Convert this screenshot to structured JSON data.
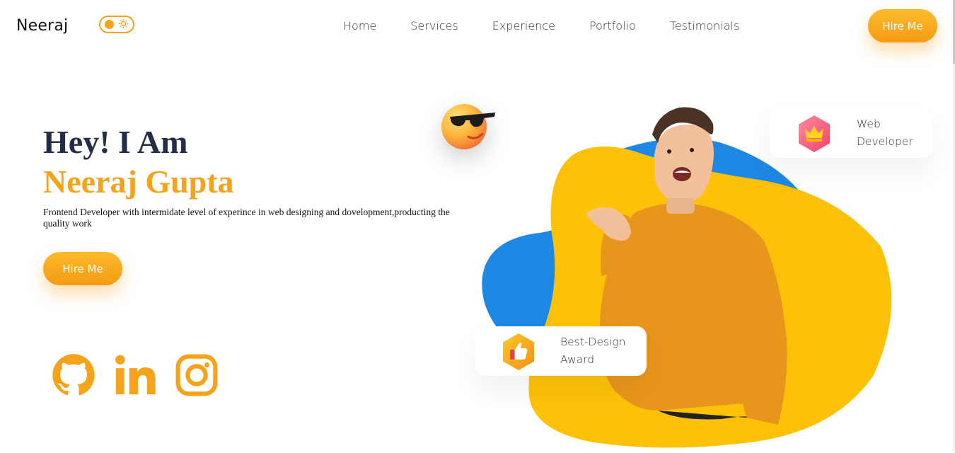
{
  "brand": {
    "name": "Neeraj",
    "accent": "#f5a31a",
    "dark": "#242d48",
    "blue": "#1e88e5",
    "yellow": "#fdc208"
  },
  "theme_toggle": {
    "icon": "sun-icon"
  },
  "nav": {
    "items": [
      {
        "label": "Home"
      },
      {
        "label": "Services"
      },
      {
        "label": "Experience"
      },
      {
        "label": "Portfolio"
      },
      {
        "label": "Testimonials"
      }
    ],
    "cta": "Hire Me"
  },
  "hero": {
    "greeting": "Hey! I Am",
    "name": "Neeraj Gupta",
    "description": "Frontend Developer with intermidate level of experince in web designing and dovelopment,producting the quality work",
    "cta": "Hire Me"
  },
  "social": [
    {
      "icon": "github-icon"
    },
    {
      "icon": "linkedin-icon"
    },
    {
      "icon": "instagram-icon"
    }
  ],
  "cards": {
    "web": {
      "line1": "Web",
      "line2": "Developer",
      "icon": "crown-icon"
    },
    "award": {
      "line1": "Best-Design",
      "line2": "Award",
      "icon": "thumbs-up-icon"
    }
  },
  "decor": {
    "emoji": "sunglasses-emoji-icon"
  }
}
